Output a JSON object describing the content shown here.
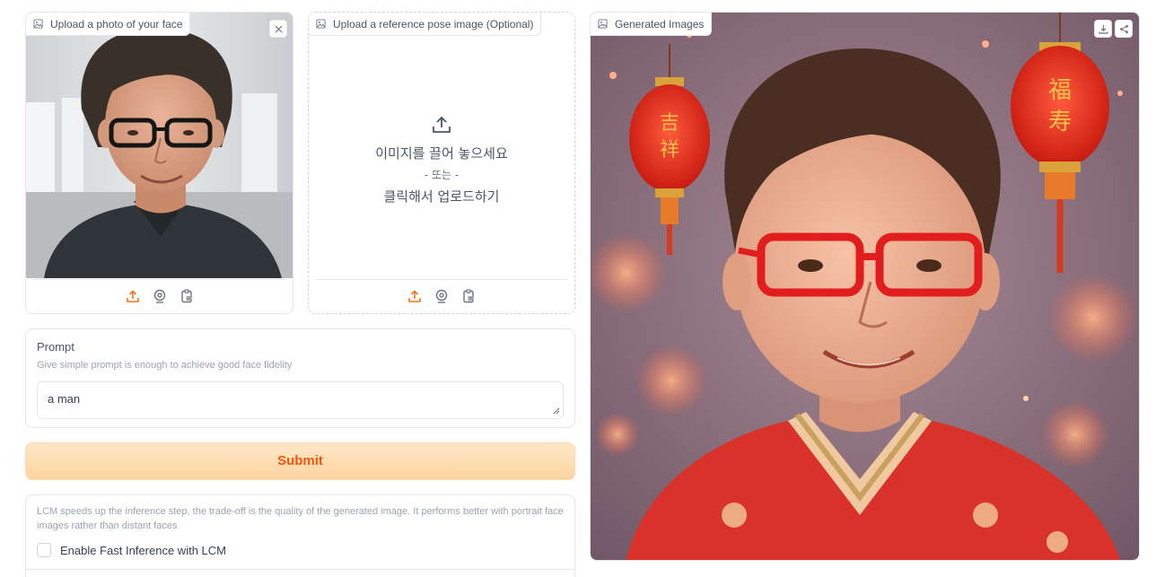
{
  "face_upload": {
    "label": "Upload a photo of your face",
    "label_icon": "image-icon",
    "close_icon": "close-icon",
    "toolbar_icons": [
      "upload-icon",
      "webcam-icon",
      "clipboard-icon"
    ]
  },
  "pose_upload": {
    "label": "Upload a reference pose image (Optional)",
    "drop_text": "이미지를 끌어 놓으세요",
    "or_text": "- 또는 -",
    "click_text": "클릭해서 업로드하기",
    "toolbar_icons": [
      "upload-icon",
      "webcam-icon",
      "clipboard-icon"
    ]
  },
  "prompt": {
    "label": "Prompt",
    "info": "Give simple prompt is enough to achieve good face fidelity",
    "value": "a man"
  },
  "submit": {
    "label": "Submit"
  },
  "lcm": {
    "info": "LCM speeds up the inference step, the trade-off is the quality of the generated image. It performs better with portrait face images rather than distant faces",
    "checkbox_label": "Enable Fast Inference with LCM",
    "checked": false
  },
  "gallery": {
    "label": "Generated Images",
    "actions": [
      "download-icon",
      "share-icon"
    ]
  },
  "colors": {
    "accent": "#f97316",
    "border": "#e5e7eb",
    "muted": "#9ca3af"
  }
}
